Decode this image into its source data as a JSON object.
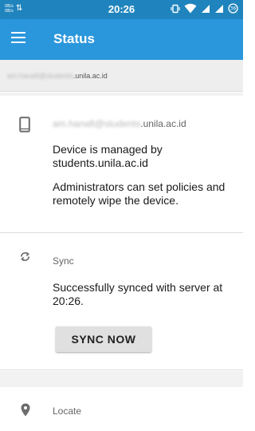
{
  "status_bar": {
    "net_speed_up": "0B/s",
    "net_speed_down": "0B/s",
    "time": "20:26",
    "icons": [
      "data-transfer-icon",
      "vibrate-icon",
      "wifi-icon",
      "signal-icon",
      "signal-icon",
      "battery-icon"
    ]
  },
  "app_bar": {
    "menu_icon": "menu-icon",
    "title": "Status"
  },
  "account": {
    "email_local": "am.hanafi@students",
    "email_domain": ".unila.ac.id"
  },
  "device_card": {
    "icon": "phone-icon",
    "email_local": "am.hanafi@students",
    "email_domain": ".unila.ac.id",
    "managed_text": "Device is managed by students.unila.ac.id",
    "policy_text": "Administrators can set policies and remotely wipe the device."
  },
  "sync_card": {
    "icon": "sync-icon",
    "label": "Sync",
    "status_text": "Successfully synced with server at 20:26.",
    "button_label": "SYNC NOW"
  },
  "locate_card": {
    "icon": "location-pin-icon",
    "label": "Locate"
  },
  "colors": {
    "status_bar": "#1f84bd",
    "app_bar": "#2a96dc",
    "button": "#e0e0e0",
    "background": "#f2f2f2"
  }
}
